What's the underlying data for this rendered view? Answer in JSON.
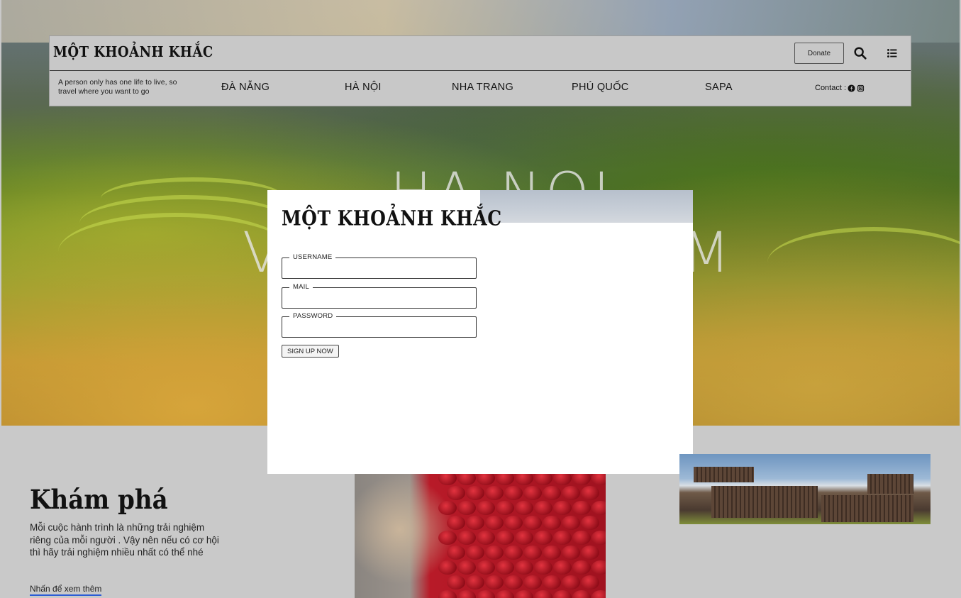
{
  "brand": {
    "logo": "MỘT KHOẢNH KHẮC"
  },
  "header": {
    "donate_label": "Donate",
    "tagline": "A person only has one life to live, so travel where you want to go",
    "nav": [
      "ĐÀ NẴNG",
      "HÀ NỘI",
      "NHA TRANG",
      "PHÚ QUỐC",
      "SAPA"
    ],
    "contact_label": "Contact :"
  },
  "hero": {
    "line1": "HA NOI",
    "line2a": "V",
    "line2b": "M"
  },
  "signup": {
    "logo": "MỘT KHOẢNH KHẮC",
    "fields": [
      {
        "label": "USERNAME",
        "value": ""
      },
      {
        "label": "MAIL",
        "value": ""
      },
      {
        "label": "PASSWORD",
        "value": ""
      }
    ],
    "button": "SIGN UP NOW"
  },
  "explore": {
    "title": "Khám phá",
    "text": "Mỗi cuộc hành trình là những trải nghiệm riêng của mỗi người . Vậy nên nếu có cơ hội thì hãy trải nghiệm nhiều nhất có thể nhé",
    "link": "Nhấn để xem thêm"
  }
}
